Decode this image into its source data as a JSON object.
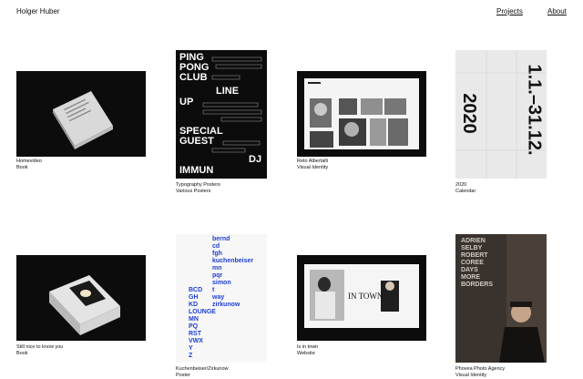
{
  "site": {
    "title": "Holger Huber"
  },
  "nav": {
    "projects": "Projects",
    "about": "About"
  },
  "projects": [
    {
      "title": "Homevideo",
      "type": "Book"
    },
    {
      "title": "Typography Posters",
      "type": "Various Posters",
      "poster_lines": [
        "PING",
        "PONG",
        "CLUB",
        "LINE",
        "UP",
        "SPECIAL",
        "GUEST",
        "DJ",
        "IMMUN"
      ]
    },
    {
      "title": "Reto Albertalli",
      "type": "Visual Identity"
    },
    {
      "title": "2020",
      "type": "Calendar",
      "cal_year": "2020",
      "cal_range": "1.1.–31.12."
    },
    {
      "title": "Still nice to know you",
      "type": "Book"
    },
    {
      "title": "Kuchenbeiser/Zirkunow",
      "type": "Poster",
      "poster_words": [
        "bernd",
        "cd",
        "fgh",
        "kuchenbeiser",
        "mn",
        "pqr",
        "simon",
        "t",
        "way",
        "zirkunow"
      ],
      "poster_left": [
        "BCD",
        "GH",
        "KD",
        "LOUNGE",
        "MN",
        "PQ",
        "RST",
        "VWX",
        "Y",
        "Z"
      ]
    },
    {
      "title": "Is in town",
      "type": "Website",
      "site_heading": "IN TOWN"
    },
    {
      "title": "Phovea Photo Agency",
      "type": "Visual Identity",
      "cover_lines": [
        "ADRIEN",
        "SELBY",
        "ROBERT",
        "COREE",
        "DAYS",
        "MORE",
        "BORDERS"
      ]
    }
  ]
}
